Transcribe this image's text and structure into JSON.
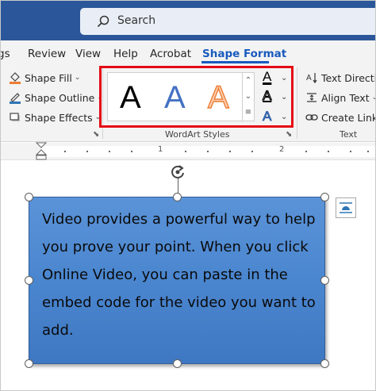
{
  "search": {
    "placeholder": "Search"
  },
  "tabs": [
    {
      "label": "gs",
      "active": false
    },
    {
      "label": "Review",
      "active": false
    },
    {
      "label": "View",
      "active": false
    },
    {
      "label": "Help",
      "active": false
    },
    {
      "label": "Acrobat",
      "active": false
    },
    {
      "label": "Shape Format",
      "active": true
    }
  ],
  "shape_styles": {
    "fill": "Shape Fill",
    "outline": "Shape Outline",
    "effects": "Shape Effects"
  },
  "wordart": {
    "group_label": "WordArt Styles",
    "samples": [
      "A",
      "A",
      "A"
    ],
    "text_fill_glyph": "A",
    "text_outline_glyph": "A",
    "text_effects_glyph": "A"
  },
  "text_group": {
    "direction": "Text Direction",
    "align": "Align Text",
    "link": "Create Link",
    "group_label": "Text"
  },
  "ruler": {
    "numbers": [
      "1",
      "2"
    ]
  },
  "document": {
    "shape_text": "Video provides a powerful way to help you prove your point. When you click Online Video, you can paste in the embed code for the video you want to add."
  },
  "colors": {
    "title_bar": "#2b579a",
    "accent": "#185abd",
    "highlight": "#e50914",
    "shape_fill": "#4a86cf"
  }
}
